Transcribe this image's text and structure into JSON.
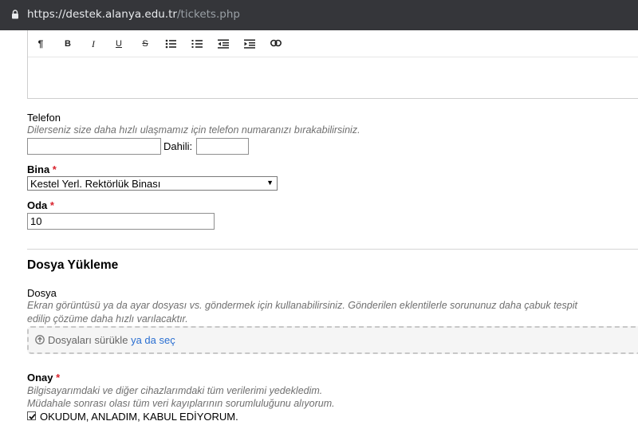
{
  "browser": {
    "url_host": "https://destek.alanya.edu.tr",
    "url_path": "/tickets.php"
  },
  "editor": {
    "toolbar": [
      {
        "name": "paragraph-icon",
        "glyph": "¶"
      },
      {
        "name": "bold-icon",
        "glyph": "B"
      },
      {
        "name": "italic-icon",
        "glyph": "I"
      },
      {
        "name": "underline-icon",
        "glyph": "U"
      },
      {
        "name": "strikethrough-icon",
        "glyph": "S"
      },
      {
        "name": "unordered-list-icon",
        "glyph": ""
      },
      {
        "name": "ordered-list-icon",
        "glyph": ""
      },
      {
        "name": "outdent-icon",
        "glyph": ""
      },
      {
        "name": "indent-icon",
        "glyph": ""
      },
      {
        "name": "link-icon",
        "glyph": ""
      }
    ]
  },
  "phone": {
    "label": "Telefon",
    "hint": "Dilerseniz size daha hızlı ulaşmamız için telefon numaranızı bırakabilirsiniz.",
    "value": "",
    "ext_label": "Dahili:",
    "ext_value": ""
  },
  "building": {
    "label": "Bina",
    "required": "*",
    "selected": "Kestel Yerl. Rektörlük Binası",
    "arrow": "▼"
  },
  "room": {
    "label": "Oda",
    "required": "*",
    "value": "10"
  },
  "upload": {
    "section_title": "Dosya Yükleme",
    "label": "Dosya",
    "hint_line1": "Ekran görüntüsü ya da ayar dosyası vs. göndermek için kullanabilirsiniz. Gönderilen eklentilerle sorununuz daha çabuk tespit",
    "hint_line2": "edilip çözüme daha hızlı varılacaktır.",
    "drop_text": "Dosyaları sürükle",
    "drop_link": "ya da seç"
  },
  "consent": {
    "label": "Onay",
    "required": "*",
    "hint_line1": "Bilgisayarımdaki ve diğer cihazlarımdaki tüm verilerimi yedekledim.",
    "hint_line2": "Müdahale sonrası olası tüm veri kayıplarının sorumluluğunu alıyorum.",
    "checkbox_label": "OKUDUM, ANLADIM, KABUL EDİYORUM.",
    "checked": true
  }
}
